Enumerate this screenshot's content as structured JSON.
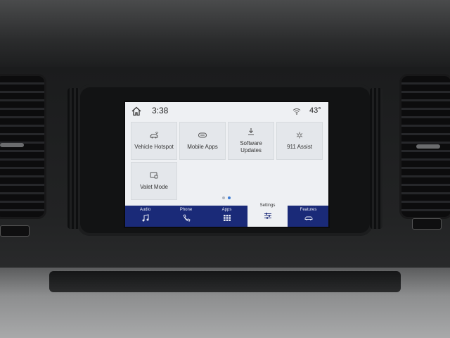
{
  "status": {
    "time": "3:38",
    "temperature": "43°"
  },
  "apps": [
    {
      "label": "Vehicle Hotspot",
      "icon": "car-wifi-icon"
    },
    {
      "label": "Mobile Apps",
      "icon": "mobile-apps-icon"
    },
    {
      "label": "Software\nUpdates",
      "icon": "download-icon"
    },
    {
      "label": "911 Assist",
      "icon": "asterisk-icon"
    },
    {
      "label": "Valet Mode",
      "icon": "valet-icon"
    }
  ],
  "pager": {
    "pages": 2,
    "current": 2
  },
  "nav": [
    {
      "label": "Audio",
      "icon": "music-note-icon"
    },
    {
      "label": "Phone",
      "icon": "phone-icon"
    },
    {
      "label": "Apps",
      "icon": "apps-grid-icon"
    },
    {
      "label": "Settings",
      "icon": "settings-sliders-icon",
      "active": true
    },
    {
      "label": "Features",
      "icon": "car-features-icon"
    }
  ],
  "colors": {
    "nav_background": "#1a2a78",
    "screen_background": "#eef0f3",
    "tile_background": "#e4e7eb",
    "pager_active": "#3a7bd5",
    "pager_inactive": "#b0b6c0"
  }
}
